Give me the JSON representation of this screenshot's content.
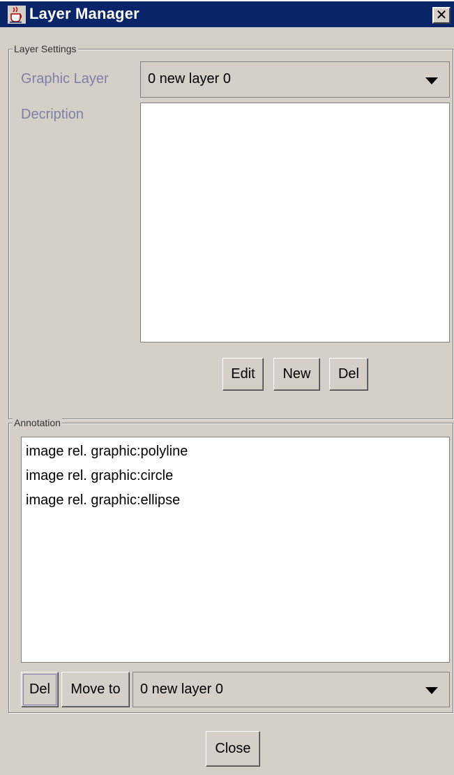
{
  "window": {
    "title": "Layer Manager",
    "close_symbol": "✕"
  },
  "layer_settings": {
    "group_title": "Layer Settings",
    "graphic_layer_label": "Graphic Layer",
    "graphic_layer_value": "0 new layer  0",
    "description_label": "Decription",
    "description_value": "",
    "buttons": {
      "edit": "Edit",
      "new": "New",
      "del": "Del"
    }
  },
  "annotation": {
    "group_title": "Annotation",
    "items": [
      "image rel. graphic:polyline",
      "image rel. graphic:circle",
      "image rel. graphic:ellipse"
    ],
    "del_label": "Del",
    "move_to_label": "Move to",
    "target_layer_value": "0 new layer  0"
  },
  "footer": {
    "close_label": "Close"
  },
  "icons": {
    "app": "java-coffee-cup-icon",
    "dropdown": "triangle-down-icon"
  }
}
